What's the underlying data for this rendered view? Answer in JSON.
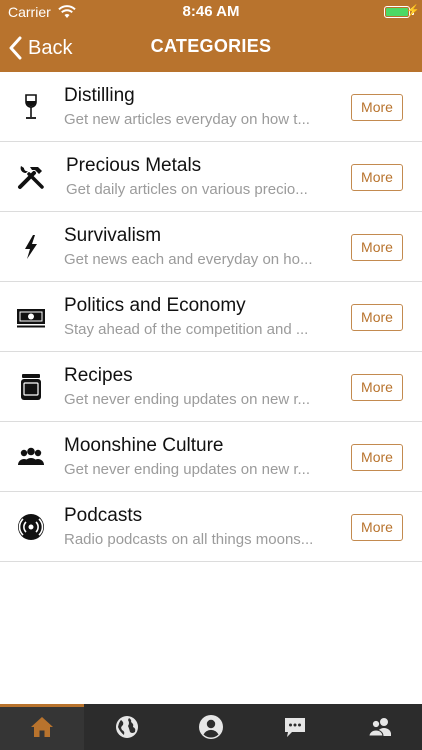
{
  "status_bar": {
    "carrier": "Carrier",
    "time": "8:46 AM",
    "battery_color": "#4cd964"
  },
  "nav": {
    "back_label": "Back",
    "title": "CATEGORIES"
  },
  "colors": {
    "brand": "#b8732d",
    "tabbar_bg": "#2c2c2c"
  },
  "categories": [
    {
      "title": "Distilling",
      "subtitle": "Get new articles everyday on how t...",
      "button": "More",
      "icon": "wine-glass-icon"
    },
    {
      "title": "Precious Metals",
      "subtitle": "Get daily articles on various precio...",
      "button": "More",
      "icon": "tools-icon"
    },
    {
      "title": "Survivalism",
      "subtitle": "Get news each and everyday on ho...",
      "button": "More",
      "icon": "lightning-icon"
    },
    {
      "title": "Politics and Economy",
      "subtitle": "Stay ahead of the competition and ...",
      "button": "More",
      "icon": "money-icon"
    },
    {
      "title": "Recipes",
      "subtitle": "Get never ending updates on new r...",
      "button": "More",
      "icon": "jar-icon"
    },
    {
      "title": "Moonshine Culture",
      "subtitle": "Get never ending updates on new r...",
      "button": "More",
      "icon": "group-icon"
    },
    {
      "title": "Podcasts",
      "subtitle": "Radio podcasts on all things moons...",
      "button": "More",
      "icon": "broadcast-icon"
    }
  ],
  "tabs": [
    {
      "icon": "home-icon",
      "active": true
    },
    {
      "icon": "globe-icon",
      "active": false
    },
    {
      "icon": "user-icon",
      "active": false
    },
    {
      "icon": "chat-icon",
      "active": false
    },
    {
      "icon": "users-icon",
      "active": false
    }
  ]
}
